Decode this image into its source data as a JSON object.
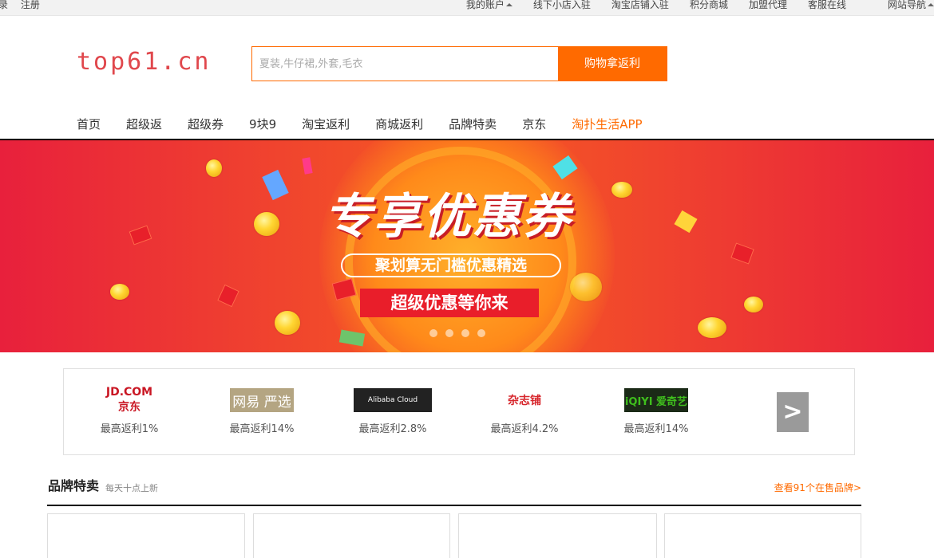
{
  "topbar": {
    "left": [
      "录",
      "注册"
    ],
    "right": [
      "我的账户",
      "线下小店入驻",
      "淘宝店铺入驻",
      "积分商城",
      "加盟代理",
      "客服在线",
      "网站导航"
    ]
  },
  "header": {
    "logo": "top61.cn",
    "search_placeholder": "夏装,牛仔裙,外套,毛衣",
    "search_button": "购物拿返利"
  },
  "nav": {
    "items": [
      "首页",
      "超级返",
      "超级券",
      "9块9",
      "淘宝返利",
      "商城返利",
      "品牌特卖",
      "京东",
      "淘扑生活APP"
    ]
  },
  "banner": {
    "headline": "专享优惠券",
    "pill": "聚划算无门槛优惠精选",
    "tag": "超级优惠等你来"
  },
  "brands": [
    {
      "logo_text": "JD.COM 京东",
      "rate": "最高返利1%"
    },
    {
      "logo_text": "网易 严选",
      "rate": "最高返利14%"
    },
    {
      "logo_text": "Alibaba Cloud",
      "rate": "最高返利2.8%"
    },
    {
      "logo_text": "杂志铺",
      "rate": "最高返利4.2%"
    },
    {
      "logo_text": "iQIYI 爱奇艺",
      "rate": "最高返利14%"
    }
  ],
  "brands_next": ">",
  "section": {
    "title": "品牌特卖",
    "subtitle": "每天十点上新",
    "more": "查看91个在售品牌>"
  },
  "colors": {
    "accent": "#ff6a00",
    "logo": "#e0474c",
    "banner": "#e8203c"
  }
}
